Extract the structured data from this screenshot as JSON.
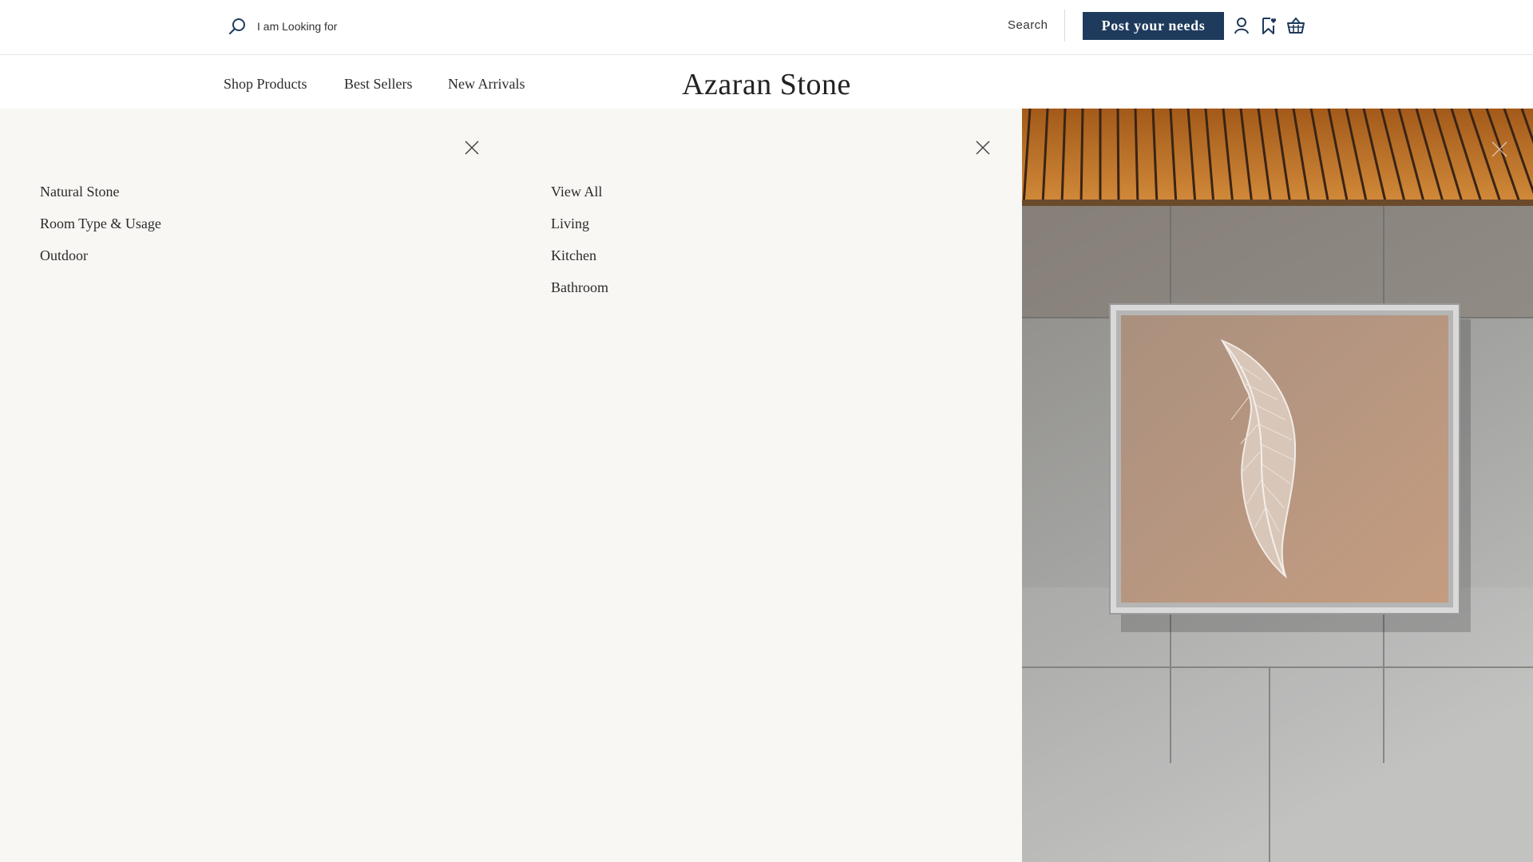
{
  "header": {
    "search_placeholder": "I am Looking for",
    "search_label": "Search",
    "post_button": "Post your needs",
    "icons": [
      "search-icon",
      "account-icon",
      "wishlist-icon",
      "basket-icon"
    ],
    "accent_color": "#1e3a5c"
  },
  "nav": {
    "links": [
      "Shop Products",
      "Best Sellers",
      "New Arrivals"
    ],
    "brand": "Azaran Stone"
  },
  "mega_menu": {
    "categories": [
      "Natural Stone",
      "Room Type & Usage",
      "Outdoor"
    ],
    "subcategories": [
      "View All",
      "Living",
      "Kitchen",
      "Bathroom"
    ],
    "background": "#f8f7f4"
  },
  "feature_image": {
    "subject": "framed-leaf-artwork-photo"
  }
}
